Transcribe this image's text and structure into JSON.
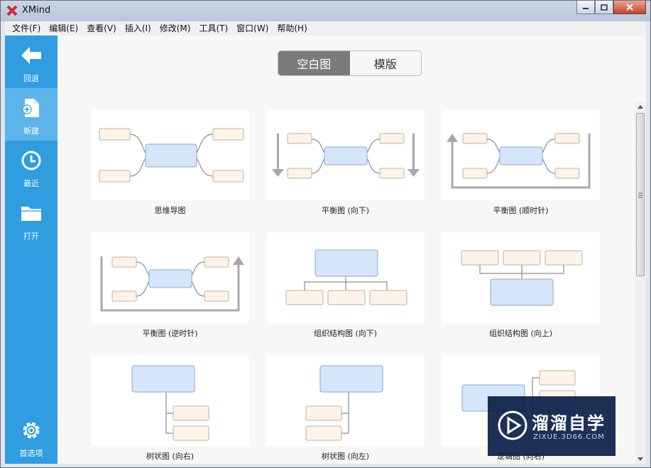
{
  "window": {
    "title": "XMind"
  },
  "menu": [
    "文件(F)",
    "编辑(E)",
    "查看(V)",
    "插入(I)",
    "修改(M)",
    "工具(T)",
    "窗口(W)",
    "帮助(H)"
  ],
  "sidebar": {
    "items": [
      {
        "label": "回退",
        "icon": "back-arrow-icon"
      },
      {
        "label": "新建",
        "icon": "new-file-icon"
      },
      {
        "label": "最近",
        "icon": "clock-icon"
      },
      {
        "label": "打开",
        "icon": "folder-icon"
      }
    ],
    "bottom": {
      "label": "首选项",
      "icon": "gear-icon"
    }
  },
  "tabs": [
    {
      "label": "空白图",
      "active": true
    },
    {
      "label": "模版",
      "active": false
    }
  ],
  "templates": [
    {
      "label": "思维导图"
    },
    {
      "label": "平衡图 (向下)"
    },
    {
      "label": "平衡图 (顺时针)"
    },
    {
      "label": "平衡图 (逆时针)"
    },
    {
      "label": "组织结构图 (向下)"
    },
    {
      "label": "组织结构图 (向上)"
    },
    {
      "label": "树状图 (向右)"
    },
    {
      "label": "树状图 (向左)"
    },
    {
      "label": "逻辑图 (向右)"
    }
  ],
  "watermark": {
    "title": "溜溜自学",
    "subtitle": "ZIXUE.3D66.COM"
  },
  "colors": {
    "sidebar": "#2f9de0",
    "central_topic": "#d5e6fb",
    "sub_topic": "#fdf3e6"
  }
}
